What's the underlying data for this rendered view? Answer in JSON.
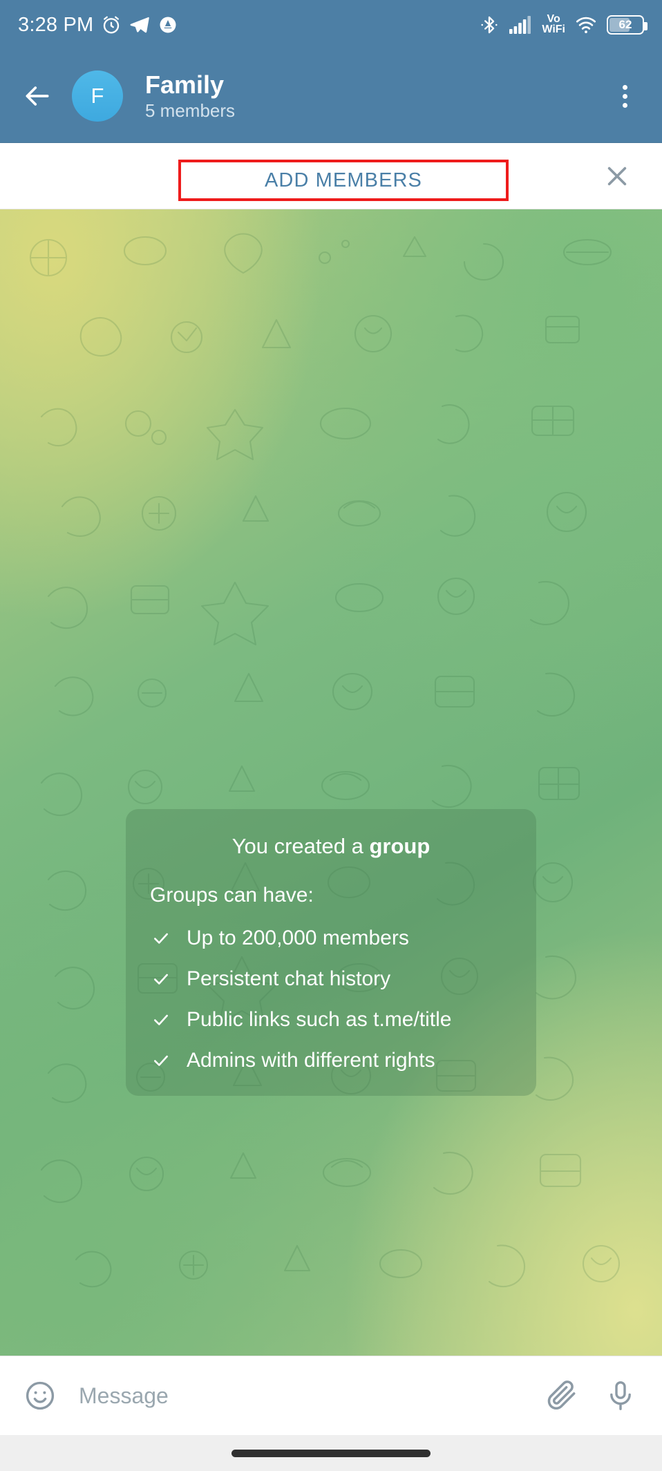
{
  "status_bar": {
    "time": "3:28 PM",
    "battery_text": "62",
    "battery_percent": 62,
    "vowifi_top": "Vo",
    "vowifi_bottom": "WiFi",
    "icons": [
      "alarm-clock-icon",
      "telegram-icon",
      "app-badge-icon",
      "bluetooth-icon",
      "cellular-signal-icon",
      "vowifi-icon",
      "wifi-icon",
      "battery-icon"
    ],
    "bar_color": "#4d7fa5",
    "text_color": "#ffffff"
  },
  "header": {
    "back_label": "Back",
    "avatar_initial": "F",
    "avatar_color": "#3ea9df",
    "title": "Family",
    "subtitle": "5 members",
    "menu_label": "More options",
    "background": "#4d7fa5"
  },
  "add_members_bar": {
    "button_label": "ADD MEMBERS",
    "button_color": "#4a7fa7",
    "highlight_color": "#ee1c1c",
    "close_label": "Close"
  },
  "service_message": {
    "title_prefix": "You created a ",
    "title_bold": "group",
    "subtitle": "Groups can have:",
    "features": [
      "Up to 200,000 members",
      "Persistent chat history",
      "Public links such as t.me/title",
      "Admins with different rights"
    ]
  },
  "input_bar": {
    "placeholder": "Message",
    "value": "",
    "emoji_label": "Emoji",
    "attach_label": "Attach",
    "mic_label": "Voice message"
  },
  "nav_bar": {
    "home_indicator_label": "Home"
  }
}
